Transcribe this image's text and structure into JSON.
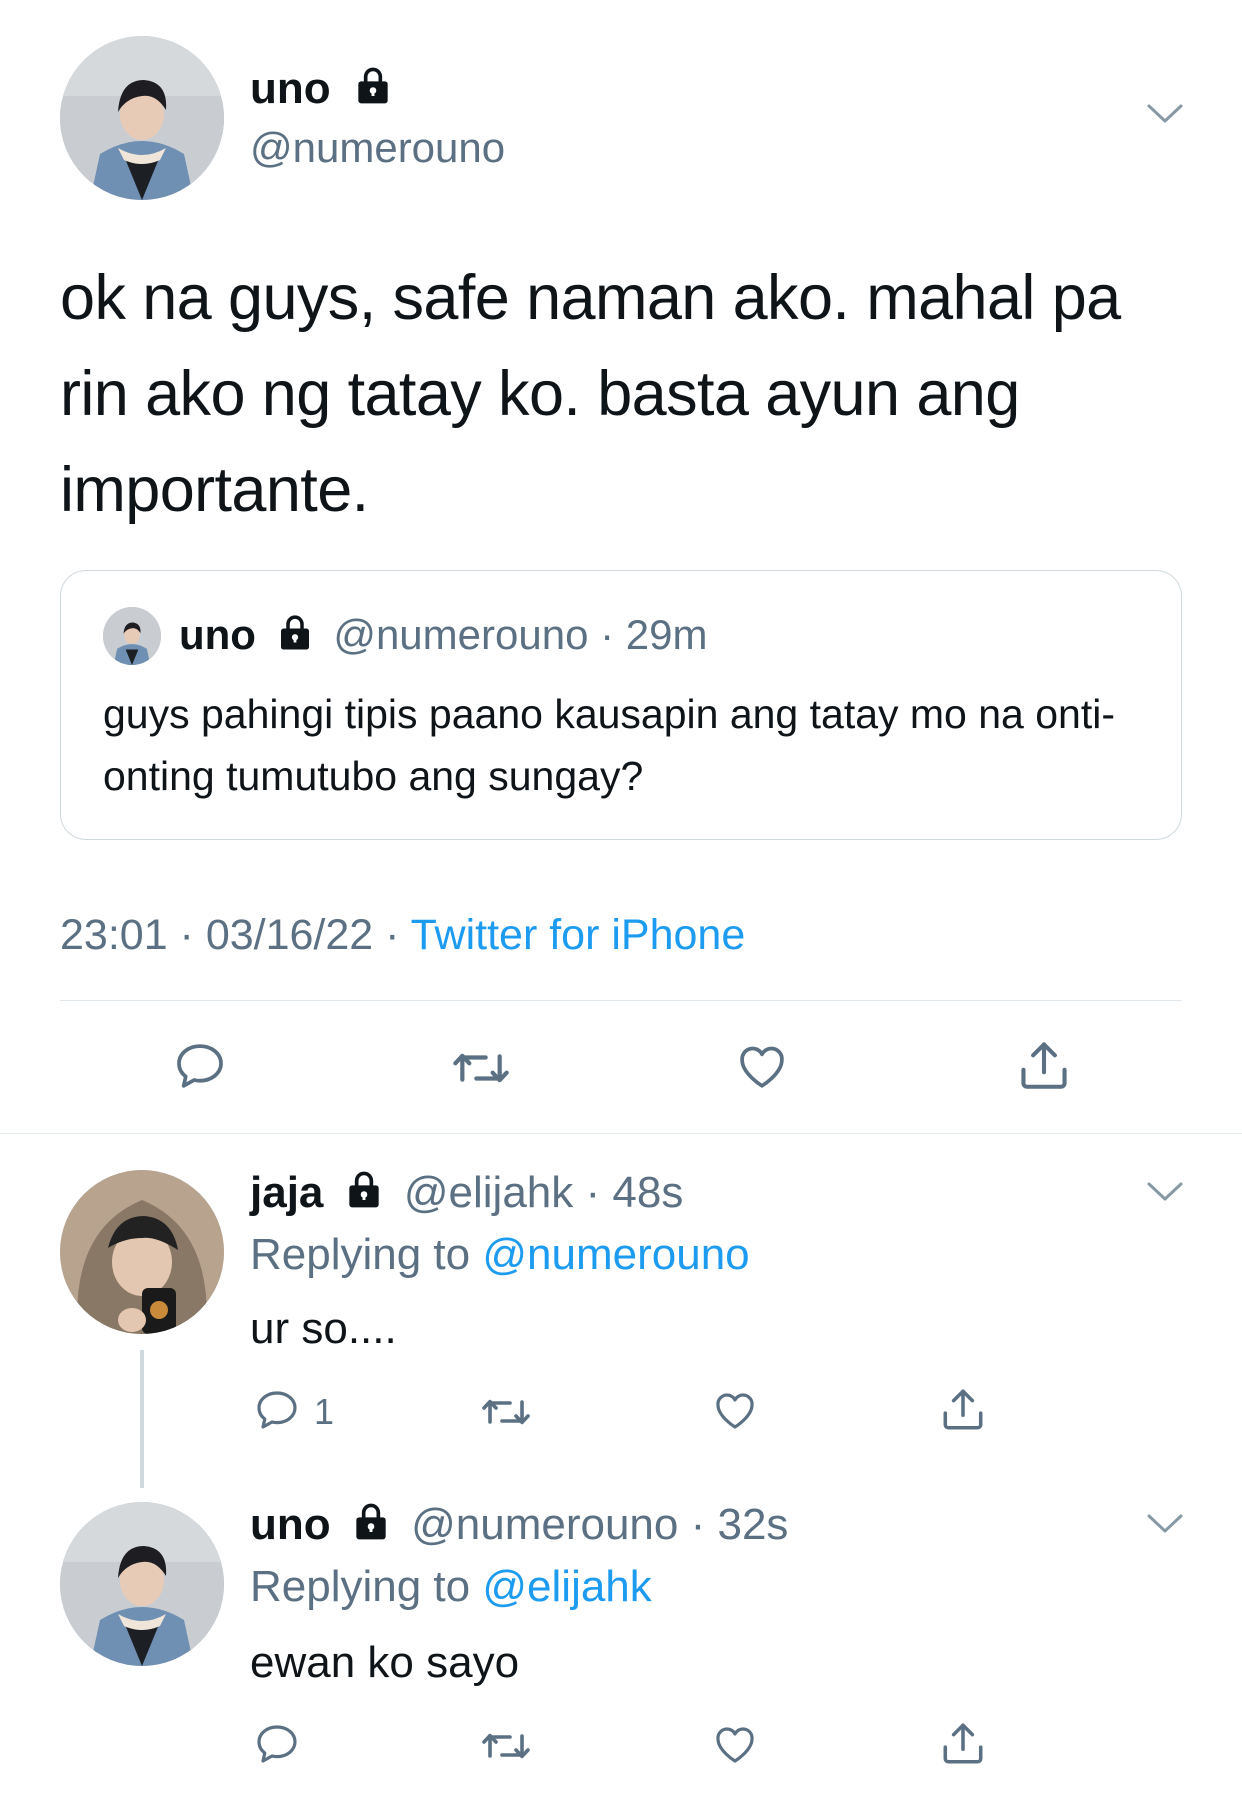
{
  "main_tweet": {
    "display_name": "uno",
    "handle": "@numerouno",
    "text": "ok na guys, safe naman ako. mahal pa rin ako ng tatay ko. basta ayun ang importante.",
    "timestamp": "23:01 · 03/16/22 ·",
    "source": "Twitter for iPhone",
    "icons": {
      "lock": "lock-icon",
      "menu": "chevron-down-icon",
      "reply": "reply-icon",
      "retweet": "retweet-icon",
      "like": "heart-icon",
      "share": "share-icon"
    }
  },
  "quoted_tweet": {
    "display_name": "uno",
    "handle": "@numerouno",
    "time": "· 29m",
    "text": "guys pahingi tipis paano kausapin ang tatay mo na onti-onting tumutubo ang sungay?"
  },
  "replies": [
    {
      "display_name": "jaja",
      "handle": "@elijahk",
      "time": "· 48s",
      "replying_label": "Replying to",
      "replying_to": "@numerouno",
      "text": "ur so....",
      "reply_count": "1"
    },
    {
      "display_name": "uno",
      "handle": "@numerouno",
      "time": "· 32s",
      "replying_label": "Replying to",
      "replying_to": "@elijahk",
      "text": "ewan ko sayo",
      "reply_count": ""
    }
  ],
  "colors": {
    "link": "#1d9bf0",
    "muted": "#5b7083",
    "divider": "#e1e8ed",
    "text": "#0f1419"
  }
}
